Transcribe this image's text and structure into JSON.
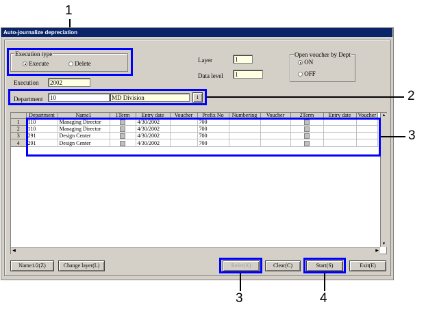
{
  "window": {
    "title": "Auto-journalize depreciation"
  },
  "execution_type": {
    "legend": "Execution type",
    "options": [
      {
        "label": "Execute",
        "selected": true
      },
      {
        "label": "Delete",
        "selected": false
      }
    ]
  },
  "execution": {
    "label": "Execution",
    "value": "2002"
  },
  "layer": {
    "label": "Layer",
    "value": "1"
  },
  "data_level": {
    "label": "Data level",
    "value": "1"
  },
  "open_voucher": {
    "legend": "Open voucher by Dept",
    "options": [
      {
        "label": "ON",
        "selected": true
      },
      {
        "label": "OFF",
        "selected": false
      }
    ]
  },
  "department": {
    "label": "Department",
    "code": "10",
    "name": "MD Division",
    "lookup_label": "1"
  },
  "grid": {
    "columns": [
      "Department",
      "Name1",
      "1Term",
      "Entry date",
      "Voucher",
      "Prefix No",
      "Numbering",
      "Voucher",
      "2Term",
      "Entry date",
      "Voucher"
    ],
    "rows": [
      {
        "n": "1",
        "dept": "110",
        "name": "Managing Director",
        "date": "4/30/2002",
        "prefix": "700"
      },
      {
        "n": "2",
        "dept": "110",
        "name": "Managing Director",
        "date": "4/30/2002",
        "prefix": "700"
      },
      {
        "n": "3",
        "dept": "291",
        "name": "Design Center",
        "date": "4/30/2002",
        "prefix": "700"
      },
      {
        "n": "4",
        "dept": "291",
        "name": "Design Center",
        "date": "4/30/2002",
        "prefix": "700"
      }
    ]
  },
  "buttons": {
    "name12": "Name1/2(Z)",
    "change_layer": "Change layer(L)",
    "refer": "Refer(X)",
    "clear": "Clear(C)",
    "start": "Start(S)",
    "exit": "Exit(E)"
  },
  "callouts": {
    "c1": "1",
    "c2": "2",
    "c3a": "3",
    "c3b": "3",
    "c4": "4"
  },
  "colors": {
    "highlight": "#0000ff",
    "titlebar": "#0a246a",
    "input_highlight": "#ffffe1"
  }
}
